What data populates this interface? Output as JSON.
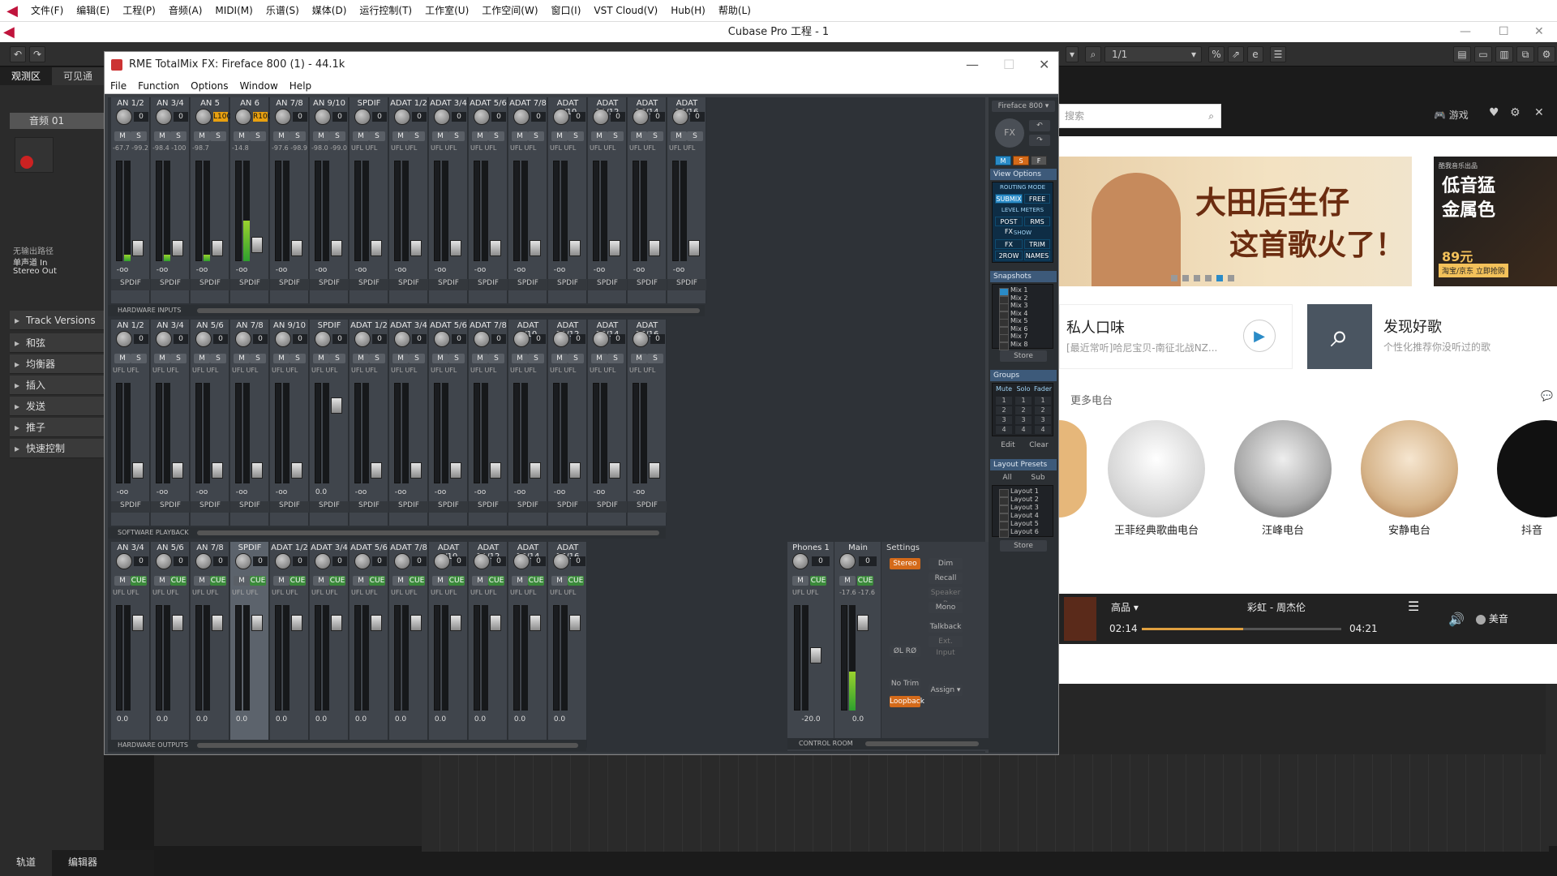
{
  "menubar": {
    "items": [
      "文件(F)",
      "编辑(E)",
      "工程(P)",
      "音频(A)",
      "MIDI(M)",
      "乐谱(S)",
      "媒体(D)",
      "运行控制(T)",
      "工作室(U)",
      "工作空间(W)",
      "窗口(I)",
      "VST Cloud(V)",
      "Hub(H)",
      "帮助(L)"
    ]
  },
  "app_title": "Cubase Pro 工程 - 1",
  "toolbar": {
    "page_display": "1/1"
  },
  "inspector": {
    "tabs": [
      "观测区",
      "可见通"
    ],
    "track_name": "音频 01",
    "routing": [
      "无输出路径",
      "单声道 In",
      "Stereo Out"
    ],
    "sections": [
      "Track Versions",
      "和弦",
      "均衡器",
      "插入",
      "发送",
      "推子",
      "快速控制"
    ]
  },
  "bottom_tabs": [
    "轨道",
    "编辑器"
  ],
  "totalmix": {
    "title": "RME TotalMix FX: Fireface 800 (1) - 44.1k",
    "menu": [
      "File",
      "Function",
      "Options",
      "Window",
      "Help"
    ],
    "row1_label": "HARDWARE INPUTS",
    "row2_label": "SOFTWARE PLAYBACK",
    "row3_label": "HARDWARE OUTPUTS",
    "ctrl_label": "CONTROL ROOM",
    "row1": [
      {
        "name": "AN 1/2",
        "knob": "0",
        "lvl": "-67.7 -99.2",
        "bottom": "-oo",
        "src": "SPDIF"
      },
      {
        "name": "AN 3/4",
        "knob": "0",
        "lvl": "-98.4 -100",
        "bottom": "-oo",
        "src": "SPDIF"
      },
      {
        "name": "AN 5",
        "knob": "L100",
        "lvl": "-98.7",
        "bottom": "-oo",
        "src": "SPDIF"
      },
      {
        "name": "AN 6",
        "knob": "R100",
        "lvl": "-14.8",
        "bottom": "-oo",
        "src": "SPDIF"
      },
      {
        "name": "AN 7/8",
        "knob": "0",
        "lvl": "-97.6 -98.9",
        "bottom": "-oo",
        "src": "SPDIF"
      },
      {
        "name": "AN 9/10",
        "knob": "0",
        "lvl": "-98.0 -99.0",
        "bottom": "-oo",
        "src": "SPDIF"
      },
      {
        "name": "SPDIF",
        "knob": "0",
        "lvl": "UFL UFL",
        "bottom": "-oo",
        "src": "SPDIF"
      },
      {
        "name": "ADAT 1/2",
        "knob": "0",
        "lvl": "UFL UFL",
        "bottom": "-oo",
        "src": "SPDIF"
      },
      {
        "name": "ADAT 3/4",
        "knob": "0",
        "lvl": "UFL UFL",
        "bottom": "-oo",
        "src": "SPDIF"
      },
      {
        "name": "ADAT 5/6",
        "knob": "0",
        "lvl": "UFL UFL",
        "bottom": "-oo",
        "src": "SPDIF"
      },
      {
        "name": "ADAT 7/8",
        "knob": "0",
        "lvl": "UFL UFL",
        "bottom": "-oo",
        "src": "SPDIF"
      },
      {
        "name": "ADAT 9/10",
        "knob": "0",
        "lvl": "UFL UFL",
        "bottom": "-oo",
        "src": "SPDIF"
      },
      {
        "name": "ADAT 11/12",
        "knob": "0",
        "lvl": "UFL UFL",
        "bottom": "-oo",
        "src": "SPDIF"
      },
      {
        "name": "ADAT 13/14",
        "knob": "0",
        "lvl": "UFL UFL",
        "bottom": "-oo",
        "src": "SPDIF"
      },
      {
        "name": "ADAT 15/16",
        "knob": "0",
        "lvl": "UFL UFL",
        "bottom": "-oo",
        "src": "SPDIF"
      }
    ],
    "row2": [
      {
        "name": "AN 1/2",
        "knob": "0",
        "lvl": "UFL UFL",
        "bottom": "-oo",
        "src": "SPDIF"
      },
      {
        "name": "AN 3/4",
        "knob": "0",
        "lvl": "UFL UFL",
        "bottom": "-oo",
        "src": "SPDIF"
      },
      {
        "name": "AN 5/6",
        "knob": "0",
        "lvl": "UFL UFL",
        "bottom": "-oo",
        "src": "SPDIF"
      },
      {
        "name": "AN 7/8",
        "knob": "0",
        "lvl": "UFL UFL",
        "bottom": "-oo",
        "src": "SPDIF"
      },
      {
        "name": "AN 9/10",
        "knob": "0",
        "lvl": "UFL UFL",
        "bottom": "-oo",
        "src": "SPDIF"
      },
      {
        "name": "SPDIF",
        "knob": "0",
        "lvl": "UFL UFL",
        "bottom": "0.0",
        "src": "SPDIF"
      },
      {
        "name": "ADAT 1/2",
        "knob": "0",
        "lvl": "UFL UFL",
        "bottom": "-oo",
        "src": "SPDIF"
      },
      {
        "name": "ADAT 3/4",
        "knob": "0",
        "lvl": "UFL UFL",
        "bottom": "-oo",
        "src": "SPDIF"
      },
      {
        "name": "ADAT 5/6",
        "knob": "0",
        "lvl": "UFL UFL",
        "bottom": "-oo",
        "src": "SPDIF"
      },
      {
        "name": "ADAT 7/8",
        "knob": "0",
        "lvl": "UFL UFL",
        "bottom": "-oo",
        "src": "SPDIF"
      },
      {
        "name": "ADAT 9/10",
        "knob": "0",
        "lvl": "UFL UFL",
        "bottom": "-oo",
        "src": "SPDIF"
      },
      {
        "name": "ADAT 11/12",
        "knob": "0",
        "lvl": "UFL UFL",
        "bottom": "-oo",
        "src": "SPDIF"
      },
      {
        "name": "ADAT 13/14",
        "knob": "0",
        "lvl": "UFL UFL",
        "bottom": "-oo",
        "src": "SPDIF"
      },
      {
        "name": "ADAT 15/16",
        "knob": "0",
        "lvl": "UFL UFL",
        "bottom": "-oo",
        "src": "SPDIF"
      }
    ],
    "row3": [
      {
        "name": "AN 3/4",
        "knob": "0",
        "lvl": "UFL UFL",
        "bottom": "0.0"
      },
      {
        "name": "AN 5/6",
        "knob": "0",
        "lvl": "UFL UFL",
        "bottom": "0.0"
      },
      {
        "name": "AN 7/8",
        "knob": "0",
        "lvl": "UFL UFL",
        "bottom": "0.0"
      },
      {
        "name": "SPDIF",
        "knob": "0",
        "lvl": "UFL UFL",
        "bottom": "0.0"
      },
      {
        "name": "ADAT 1/2",
        "knob": "0",
        "lvl": "UFL UFL",
        "bottom": "0.0"
      },
      {
        "name": "ADAT 3/4",
        "knob": "0",
        "lvl": "UFL UFL",
        "bottom": "0.0"
      },
      {
        "name": "ADAT 5/6",
        "knob": "0",
        "lvl": "UFL UFL",
        "bottom": "0.0"
      },
      {
        "name": "ADAT 7/8",
        "knob": "0",
        "lvl": "UFL UFL",
        "bottom": "0.0"
      },
      {
        "name": "ADAT 9/10",
        "knob": "0",
        "lvl": "UFL UFL",
        "bottom": "0.0"
      },
      {
        "name": "ADAT 11/12",
        "knob": "0",
        "lvl": "UFL UFL",
        "bottom": "0.0"
      },
      {
        "name": "ADAT 13/14",
        "knob": "0",
        "lvl": "UFL UFL",
        "bottom": "0.0"
      },
      {
        "name": "ADAT 15/16",
        "knob": "0",
        "lvl": "UFL UFL",
        "bottom": "0.0"
      }
    ],
    "control_room": {
      "phones": {
        "name": "Phones 1",
        "knob": "0",
        "lvl": "UFL UFL",
        "bottom": "-20.0"
      },
      "main": {
        "name": "Main",
        "knob": "0",
        "lvl": "-17.6 -17.6",
        "bottom": "0.0"
      },
      "settings": "Settings",
      "stereo": "Stereo",
      "buttons": [
        "Dim",
        "Recall",
        "Speaker B",
        "Mono",
        "Talkback",
        "Ext. Input"
      ],
      "phase": "ØL RØ",
      "no_trim": "No Trim",
      "loopback": "Loopback",
      "assign": "Assign"
    },
    "panel": {
      "device": "Fireface 800",
      "fx": "FX",
      "msf": [
        "M",
        "S",
        "F"
      ],
      "view_options": "View Options",
      "routing_mode": "ROUTING MODE",
      "submix": "SUBMIX",
      "free": "FREE",
      "level_meters": "LEVEL METERS",
      "postfx": "POST FX",
      "rms": "RMS",
      "show": "SHOW",
      "fx2": "FX",
      "trim": "TRIM",
      "row2": "2ROW",
      "names": "NAMES",
      "snapshots": "Snapshots",
      "mixes": [
        "Mix 1",
        "Mix 2",
        "Mix 3",
        "Mix 4",
        "Mix 5",
        "Mix 6",
        "Mix 7",
        "Mix 8"
      ],
      "store": "Store",
      "groups": "Groups",
      "group_cols": [
        "Mute",
        "Solo",
        "Fader"
      ],
      "group_nums": [
        "1",
        "2",
        "3",
        "4"
      ],
      "edit": "Edit",
      "clear": "Clear",
      "layout_presets": "Layout Presets",
      "all": "All",
      "sub": "Sub",
      "layouts": [
        "Layout 1",
        "Layout 2",
        "Layout 3",
        "Layout 4",
        "Layout 5",
        "Layout 6"
      ],
      "store2": "Store"
    },
    "strip_m": "M",
    "strip_s": "S",
    "strip_cue": "CUE"
  },
  "music": {
    "search_placeholder": "搜索",
    "nav": [
      "游戏"
    ],
    "banner1_text1": "大田后生仔",
    "banner1_text2": "这首歌火了！",
    "banner2_tag": "酷我音乐出品",
    "banner2_text": "低音猛金属色",
    "banner2_price": "89元",
    "banner2_cta": "淘宝/京东 立即抢购",
    "card1_title": "私人口味",
    "card1_sub": "[最近常听]哈尼宝贝-南征北战NZ...",
    "card2_title": "发现好歌",
    "card2_sub": "个性化推荐你没听过的歌",
    "more_label": "更多电台",
    "stations": [
      "王菲经典歌曲电台",
      "汪峰电台",
      "安静电台",
      "抖音"
    ],
    "player": {
      "quality": "高品",
      "track": "彩虹 - 周杰伦",
      "elapsed": "02:14",
      "total": "04:21",
      "sound": "美音",
      "progress": 0.51
    }
  }
}
